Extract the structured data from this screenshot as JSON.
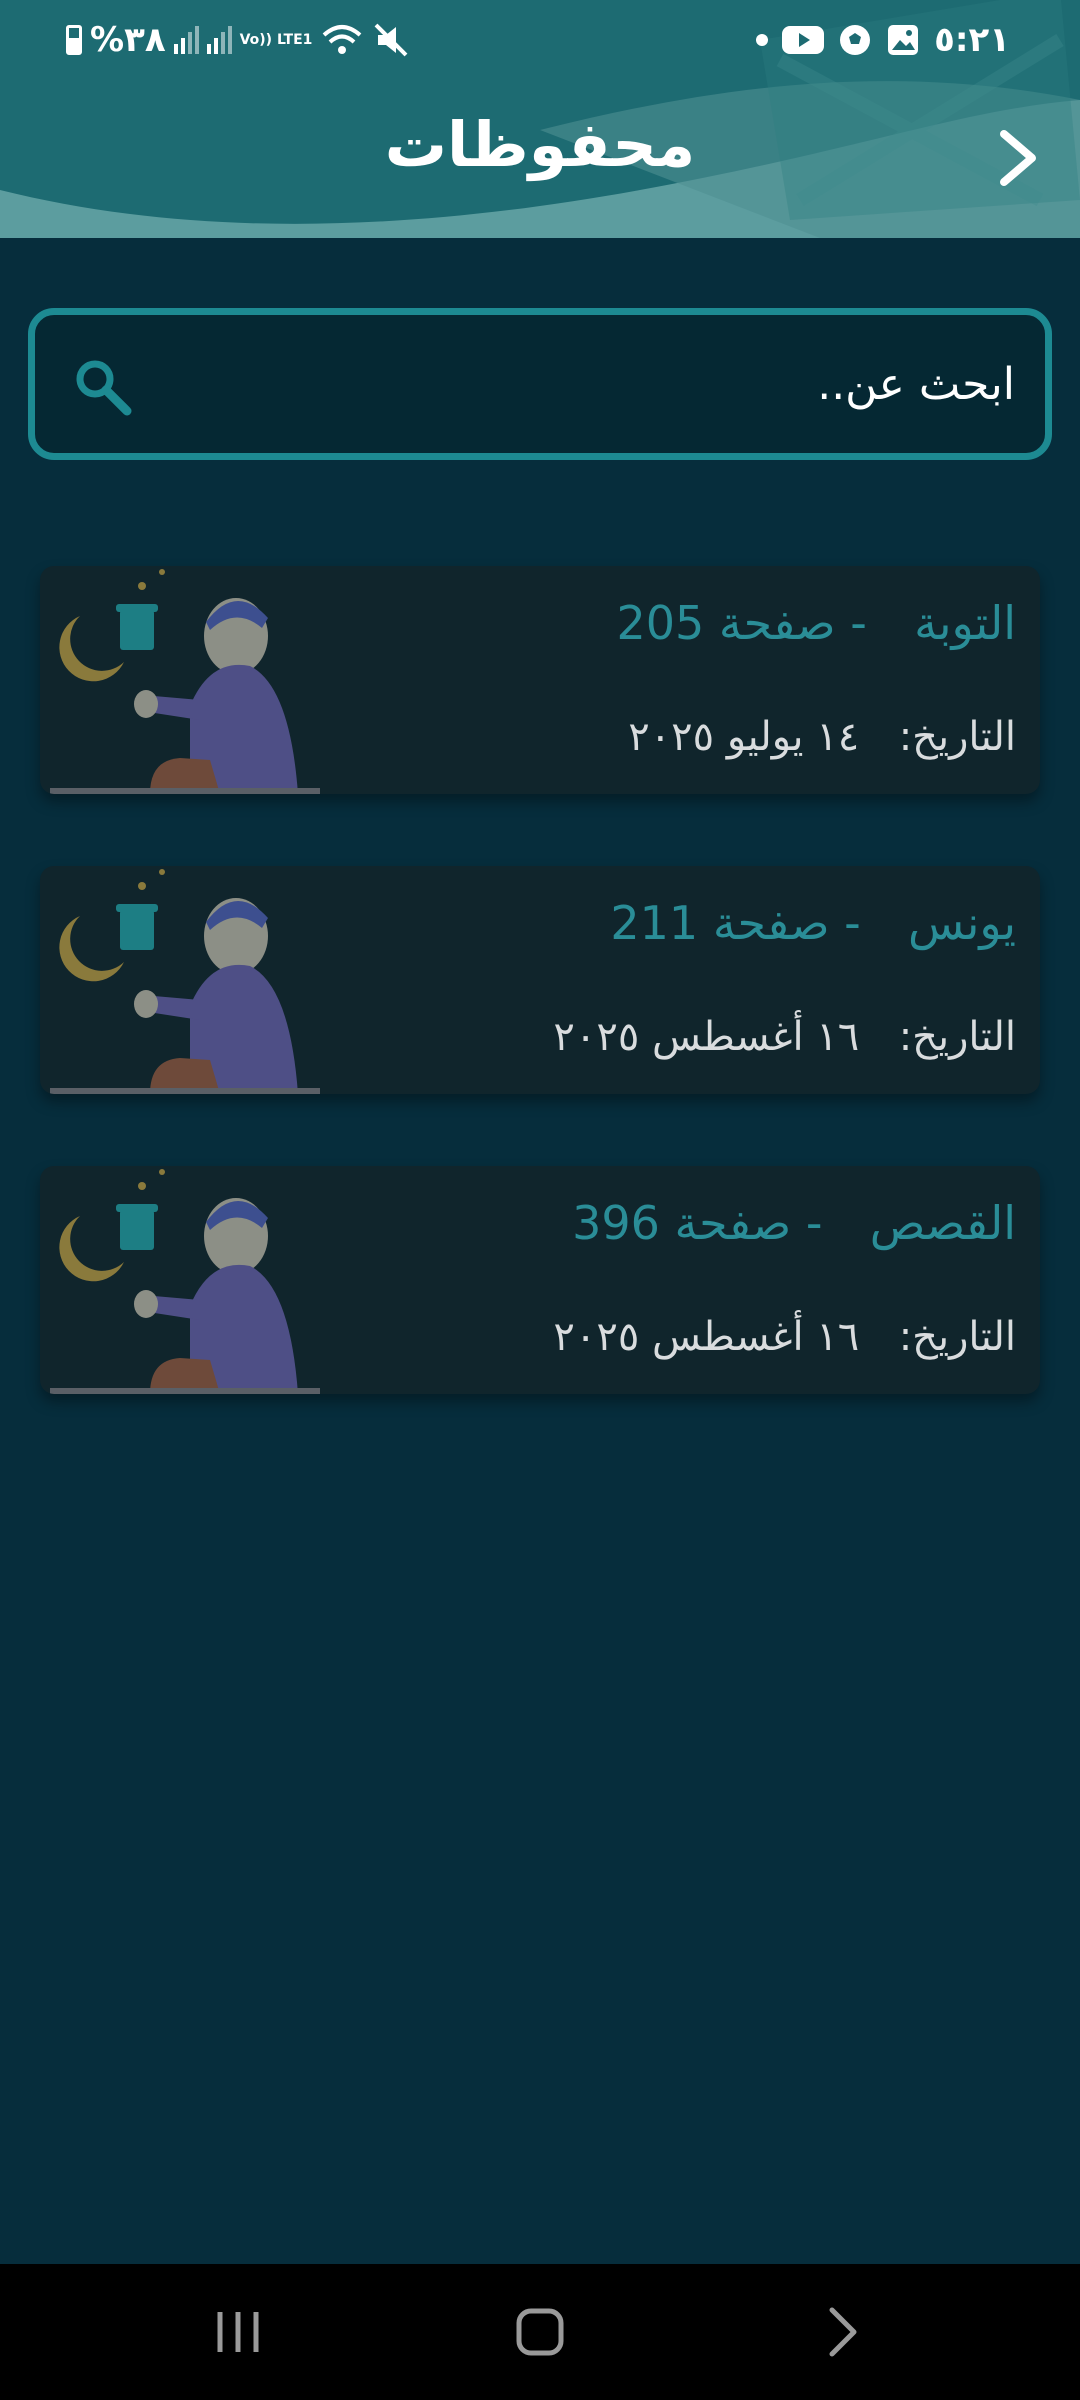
{
  "status_bar": {
    "time": "٥:٢١",
    "battery": "%٣٨",
    "network": "Vo)) LTE1",
    "icons": [
      "dot-icon",
      "youtube-icon",
      "football-icon",
      "gallery-icon",
      "battery-icon",
      "signal-icon",
      "wifi-icon",
      "mute-icon"
    ]
  },
  "header": {
    "title": "محفوظات",
    "back_icon": "chevron-right-icon"
  },
  "search": {
    "placeholder": "ابحث عن..",
    "value": "",
    "icon": "search-icon"
  },
  "bookmarks": [
    {
      "surah": "التوبة",
      "separator": "-",
      "page_label": "صفحة",
      "page": "205",
      "date_label": "التاريخ:",
      "date": "١٤ يوليو ٢٠٢٥"
    },
    {
      "surah": "يونس",
      "separator": "-",
      "page_label": "صفحة",
      "page": "211",
      "date_label": "التاريخ:",
      "date": "١٦ أغسطس ٢٠٢٥"
    },
    {
      "surah": "القصص",
      "separator": "-",
      "page_label": "صفحة",
      "page": "396",
      "date_label": "التاريخ:",
      "date": "١٦ أغسطس ٢٠٢٥"
    }
  ],
  "colors": {
    "background": "#062d3c",
    "header": "#1d6b72",
    "accent": "#1d8a92",
    "card": "#10252c",
    "card_title": "#2a8d97",
    "card_date": "#d9dcde"
  },
  "nav_bar": {
    "icons": [
      "recents-icon",
      "home-icon",
      "back-icon"
    ]
  }
}
